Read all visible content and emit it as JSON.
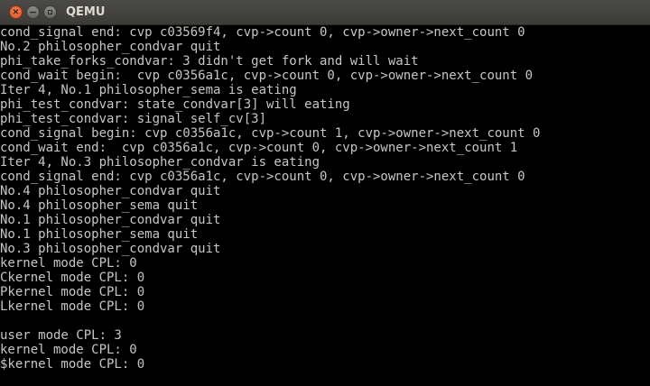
{
  "window": {
    "title": "QEMU",
    "close_glyph": "×",
    "minimize_glyph": "−"
  },
  "console": {
    "lines": [
      "cond_signal end: cvp c03569f4, cvp->count 0, cvp->owner->next_count 0",
      "No.2 philosopher_condvar quit",
      "phi_take_forks_condvar: 3 didn't get fork and will wait",
      "cond_wait begin:  cvp c0356a1c, cvp->count 0, cvp->owner->next_count 0",
      "Iter 4, No.1 philosopher_sema is eating",
      "phi_test_condvar: state_condvar[3] will eating",
      "phi_test_condvar: signal self_cv[3]",
      "cond_signal begin: cvp c0356a1c, cvp->count 1, cvp->owner->next_count 0",
      "cond_wait end:  cvp c0356a1c, cvp->count 0, cvp->owner->next_count 1",
      "Iter 4, No.3 philosopher_condvar is eating",
      "cond_signal end: cvp c0356a1c, cvp->count 0, cvp->owner->next_count 0",
      "No.4 philosopher_condvar quit",
      "No.4 philosopher_sema quit",
      "No.1 philosopher_condvar quit",
      "No.1 philosopher_sema quit",
      "No.3 philosopher_condvar quit",
      "kernel mode CPL: 0",
      "Ckernel mode CPL: 0",
      "Pkernel mode CPL: 0",
      "Lkernel mode CPL: 0",
      "",
      "user mode CPL: 3",
      "kernel mode CPL: 0",
      "$kernel mode CPL: 0"
    ]
  }
}
